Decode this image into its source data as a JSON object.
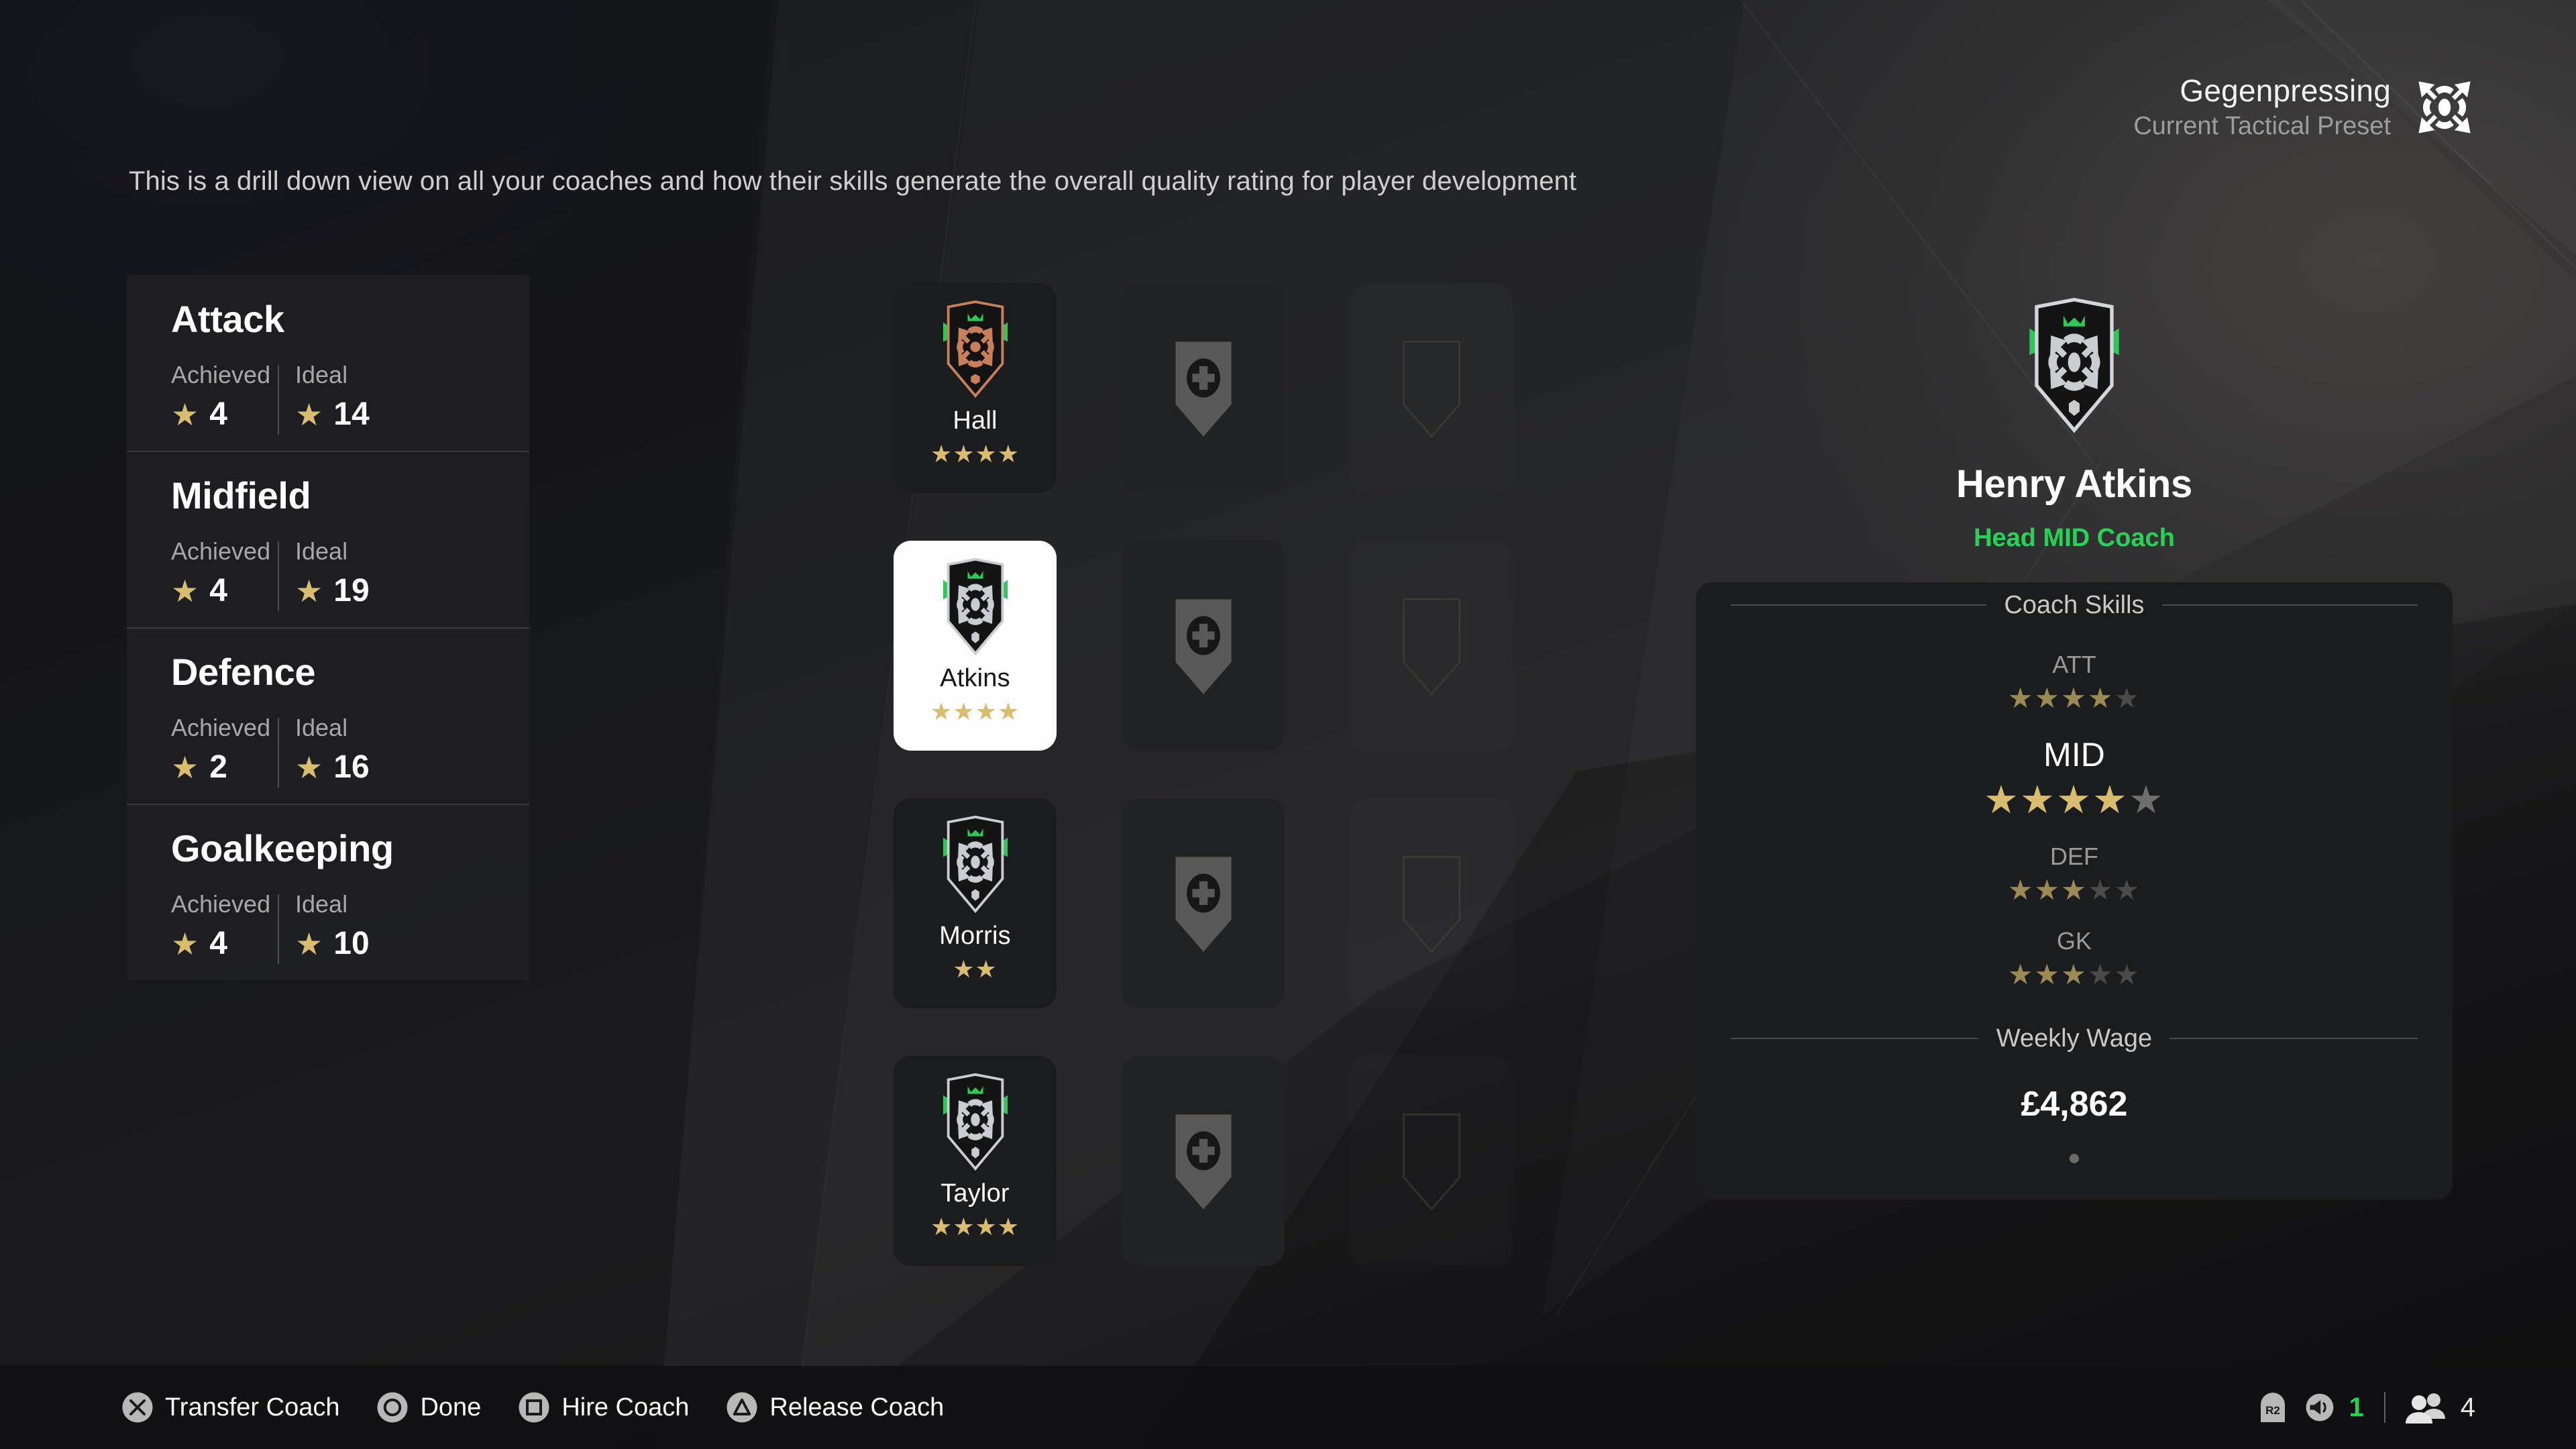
{
  "header": {
    "preset_name": "Gegenpressing",
    "preset_caption": "Current Tactical Preset",
    "preset_icon": "tactical-gegenpressing-icon"
  },
  "description": "This is a drill down view on all your coaches and how their skills generate the overall quality rating for player development",
  "categories": {
    "achieved_label": "Achieved",
    "ideal_label": "Ideal",
    "items": [
      {
        "name": "Attack",
        "achieved": "4",
        "ideal": "14"
      },
      {
        "name": "Midfield",
        "achieved": "4",
        "ideal": "19"
      },
      {
        "name": "Defence",
        "achieved": "2",
        "ideal": "16"
      },
      {
        "name": "Goalkeeping",
        "achieved": "4",
        "ideal": "10"
      }
    ]
  },
  "coach_grid": {
    "rows": [
      {
        "coach": {
          "name": "Hall",
          "stars": 4,
          "badge_color": "#c8805b",
          "selected": false
        }
      },
      {
        "coach": {
          "name": "Atkins",
          "stars": 4,
          "badge_color": "#c9ccd1",
          "selected": true
        }
      },
      {
        "coach": {
          "name": "Morris",
          "stars": 2,
          "badge_color": "#c9ccd1",
          "selected": false
        }
      },
      {
        "coach": {
          "name": "Taylor",
          "stars": 4,
          "badge_color": "#c9ccd1",
          "selected": false
        }
      }
    ],
    "add_slot_icon": "add-coach-plus-icon",
    "empty_slot_icon": "empty-coach-shield-icon"
  },
  "detail": {
    "coach_name": "Henry Atkins",
    "coach_role": "Head MID Coach",
    "role_color": "#27d356",
    "skills_header": "Coach Skills",
    "skills": [
      {
        "label": "ATT",
        "filled": 4,
        "total": 5,
        "primary": false
      },
      {
        "label": "MID",
        "filled": 4,
        "total": 5,
        "primary": true
      },
      {
        "label": "DEF",
        "filled": 3,
        "total": 5,
        "primary": false
      },
      {
        "label": "GK",
        "filled": 3,
        "total": 5,
        "primary": false
      }
    ],
    "wage_header": "Weekly Wage",
    "wage_value": "£4,862",
    "page_dots": 1,
    "active_dot": 0
  },
  "bottom_bar": {
    "prompts": [
      {
        "button": "cross-button-icon",
        "label": "Transfer Coach"
      },
      {
        "button": "circle-button-icon",
        "label": "Done"
      },
      {
        "button": "square-button-icon",
        "label": "Hire Coach"
      },
      {
        "button": "triangle-button-icon",
        "label": "Release Coach"
      }
    ],
    "status": {
      "trigger_label": "R2",
      "volume_icon": "speaker-icon",
      "volume_value": "1",
      "volume_color": "#22d44f",
      "players_icon": "people-icon",
      "players_value": "4"
    }
  },
  "theme": {
    "star_gold": "#d9bd6e",
    "star_empty": "#6e6e6e",
    "accent_green": "#27d356",
    "panel_bg": "#1b1c1e"
  }
}
